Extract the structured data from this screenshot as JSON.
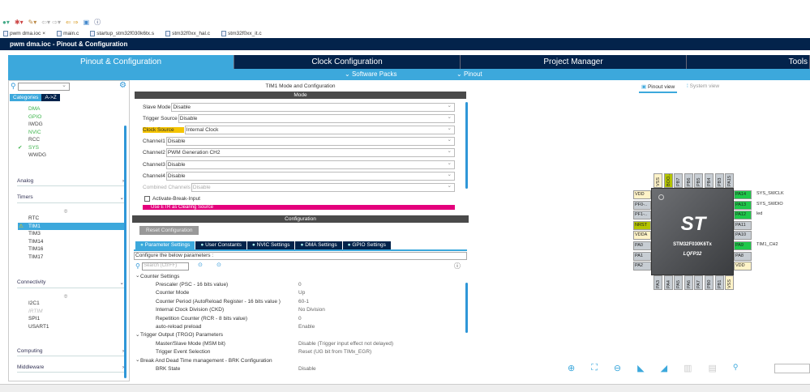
{
  "editor_tabs": [
    "pwm dma.ioc",
    "main.c",
    "startup_stm32f030k6tx.s",
    "stm32f0xx_hal.c",
    "stm32f0xx_it.c"
  ],
  "header": {
    "title": "pwm dma.ioc - Pinout & Configuration"
  },
  "main_tabs": [
    "Pinout & Configuration",
    "Clock Configuration",
    "Project Manager",
    "Tools"
  ],
  "subbar": {
    "software_packs": "Software Packs",
    "pinout": "Pinout"
  },
  "left": {
    "tabs": [
      "Categories",
      "A->Z"
    ],
    "system_items": [
      {
        "label": "DMA",
        "state": "green"
      },
      {
        "label": "GPIO",
        "state": "green"
      },
      {
        "label": "IWDG",
        "state": "normal"
      },
      {
        "label": "NVIC",
        "state": "green"
      },
      {
        "label": "RCC",
        "state": "normal"
      },
      {
        "label": "SYS",
        "state": "check"
      },
      {
        "label": "WWDG",
        "state": "normal"
      }
    ],
    "sections": {
      "analog": "Analog",
      "timers": "Timers",
      "connectivity": "Connectivity",
      "computing": "Computing",
      "middleware": "Middleware"
    },
    "timers": [
      "RTC",
      "TIM1",
      "TIM3",
      "TIM14",
      "TIM16",
      "TIM17"
    ],
    "selected_timer": "TIM1",
    "connectivity": [
      "I2C1",
      "IRTIM",
      "SPI1",
      "USART1"
    ]
  },
  "mode": {
    "title": "TIM1 Mode and Configuration",
    "bar": "Mode",
    "fields": [
      {
        "label": "Slave Mode",
        "value": "Disable"
      },
      {
        "label": "Trigger Source",
        "value": "Disable"
      },
      {
        "label": "Clock Source",
        "value": "Internal Clock",
        "highlight": true
      },
      {
        "label": "Channel1",
        "value": "Disable"
      },
      {
        "label": "Channel2",
        "value": "PWM Generation CH2"
      },
      {
        "label": "Channel3",
        "value": "Disable"
      },
      {
        "label": "Channel4",
        "value": "Disable"
      },
      {
        "label": "Combined Channels",
        "value": "Disable",
        "disabled": true
      }
    ],
    "checkbox": "Activate-Break-Input",
    "etr": "Use ETR as Clearing Source"
  },
  "config": {
    "bar": "Configuration",
    "reset": "Reset Configuration",
    "tabs": [
      "Parameter Settings",
      "User Constants",
      "NVIC Settings",
      "DMA Settings",
      "GPIO Settings"
    ],
    "hint": "Configure the below parameters :",
    "search_placeholder": "Search (Ctrl+F)",
    "params": [
      {
        "group": "Counter Settings"
      },
      {
        "k": "Prescaler (PSC - 16 bits value)",
        "v": "0"
      },
      {
        "k": "Counter Mode",
        "v": "Up"
      },
      {
        "k": "Counter Period (AutoReload Register - 16 bits value )",
        "v": "60-1"
      },
      {
        "k": "Internal Clock Division (CKD)",
        "v": "No Division"
      },
      {
        "k": "Repetition Counter (RCR - 8 bits value)",
        "v": "0"
      },
      {
        "k": "auto-reload preload",
        "v": "Enable"
      },
      {
        "group": "Trigger Output (TRGO) Parameters"
      },
      {
        "k": "Master/Slave Mode (MSM bit)",
        "v": "Disable (Trigger input effect not delayed)"
      },
      {
        "k": "Trigger Event Selection",
        "v": "Reset (UG bit from TIMx_EGR)"
      },
      {
        "group": "Break And Dead Time management - BRK Configuration"
      },
      {
        "k": "BRK State",
        "v": "Disable"
      }
    ]
  },
  "pinout": {
    "views": [
      "Pinout view",
      "System view"
    ],
    "chip_name": "STM32F030K6Tx",
    "package": "LQFP32",
    "top": [
      {
        "n": "VSS",
        "t": "pwr"
      },
      {
        "n": "BOO..",
        "t": "yel"
      },
      {
        "n": "PB7"
      },
      {
        "n": "PB6"
      },
      {
        "n": "PB5"
      },
      {
        "n": "PB4"
      },
      {
        "n": "PB3"
      },
      {
        "n": "PA15"
      }
    ],
    "left": [
      {
        "n": "VDD",
        "t": "pwr"
      },
      {
        "n": "PF0-.."
      },
      {
        "n": "PF1-.."
      },
      {
        "n": "NRST",
        "t": "yel"
      },
      {
        "n": "VDDA",
        "t": "pwr"
      },
      {
        "n": "PA0"
      },
      {
        "n": "PA1"
      },
      {
        "n": "PA2"
      }
    ],
    "right": [
      {
        "n": "PA14",
        "t": "green",
        "l": "SYS_SWCLK"
      },
      {
        "n": "PA13",
        "t": "green",
        "l": "SYS_SWDIO"
      },
      {
        "n": "PA12",
        "t": "green",
        "l": "led"
      },
      {
        "n": "PA11"
      },
      {
        "n": "PA10"
      },
      {
        "n": "PA9",
        "t": "green",
        "l": "TIM1_CH2"
      },
      {
        "n": "PA8"
      },
      {
        "n": "VDD",
        "t": "pwr"
      }
    ],
    "bottom": [
      {
        "n": "PA3"
      },
      {
        "n": "PA4"
      },
      {
        "n": "PA5"
      },
      {
        "n": "PA6"
      },
      {
        "n": "PA7"
      },
      {
        "n": "PB0"
      },
      {
        "n": "PB1"
      },
      {
        "n": "VSS",
        "t": "pwr"
      }
    ]
  }
}
